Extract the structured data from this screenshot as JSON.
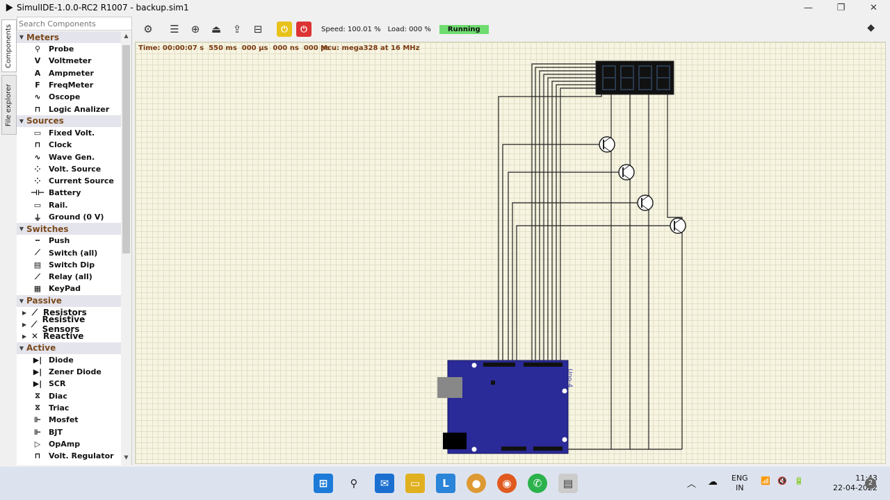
{
  "window": {
    "title": "SimulIDE-1.0.0-RC2 R1007 - backup.sim1",
    "minimize": "—",
    "restore": "❐",
    "close": "✕"
  },
  "side_tabs": [
    "Components",
    "File explorer"
  ],
  "search": {
    "placeholder": "Search Components"
  },
  "categories": [
    {
      "name": "Meters",
      "items": [
        {
          "label": "Probe",
          "icon": "⚲"
        },
        {
          "label": "Voltmeter",
          "icon": "V"
        },
        {
          "label": "Ampmeter",
          "icon": "A"
        },
        {
          "label": "FreqMeter",
          "icon": "F"
        },
        {
          "label": "Oscope",
          "icon": "∿"
        },
        {
          "label": "Logic Analizer",
          "icon": "⊓"
        }
      ]
    },
    {
      "name": "Sources",
      "items": [
        {
          "label": "Fixed Volt.",
          "icon": "▭"
        },
        {
          "label": "Clock",
          "icon": "⊓"
        },
        {
          "label": "Wave Gen.",
          "icon": "∿"
        },
        {
          "label": "Volt. Source",
          "icon": "⁘"
        },
        {
          "label": "Current Source",
          "icon": "⁘"
        },
        {
          "label": "Battery",
          "icon": "⊣⊢"
        },
        {
          "label": "Rail.",
          "icon": "▭"
        },
        {
          "label": "Ground (0 V)",
          "icon": "⏚"
        }
      ]
    },
    {
      "name": "Switches",
      "items": [
        {
          "label": "Push",
          "icon": "╍"
        },
        {
          "label": "Switch (all)",
          "icon": "⟋"
        },
        {
          "label": "Switch Dip",
          "icon": "▤"
        },
        {
          "label": "Relay (all)",
          "icon": "⟋"
        },
        {
          "label": "KeyPad",
          "icon": "▦"
        }
      ]
    },
    {
      "name": "Passive",
      "subs": [
        {
          "label": "Resistors",
          "icon": "⟋"
        },
        {
          "label": "Resistive Sensors",
          "icon": "⟋"
        },
        {
          "label": "Reactive",
          "icon": "✕"
        }
      ]
    },
    {
      "name": "Active",
      "items": [
        {
          "label": "Diode",
          "icon": "▶|"
        },
        {
          "label": "Zener Diode",
          "icon": "▶|"
        },
        {
          "label": "SCR",
          "icon": "▶|"
        },
        {
          "label": "Diac",
          "icon": "⧖"
        },
        {
          "label": "Triac",
          "icon": "⧖"
        },
        {
          "label": "Mosfet",
          "icon": "⊩"
        },
        {
          "label": "BJT",
          "icon": "⊩"
        },
        {
          "label": "OpAmp",
          "icon": "▷"
        },
        {
          "label": "Volt. Regulator",
          "icon": "⊓"
        }
      ]
    }
  ],
  "toolbar": {
    "speed": "Speed: 100.01 %",
    "load": "Load: 000 %",
    "running": "Running"
  },
  "sim_status": {
    "time": "Time: 00:00:07 s  550 ms  000 µs  000 ns  000 ps",
    "mcu": "Mcu: mega328 at 16 MHz"
  },
  "board_label": "Uno-4",
  "taskbar": {
    "lang_1": "ENG",
    "lang_2": "IN",
    "time": "11:43",
    "date": "22-04-2022",
    "notifications": "2"
  },
  "colors": {
    "canvas_bg": "#f7f5e2",
    "status_text": "#7a3a12",
    "running_bg": "#6fdc6f",
    "board_blue": "#2a2a98"
  }
}
